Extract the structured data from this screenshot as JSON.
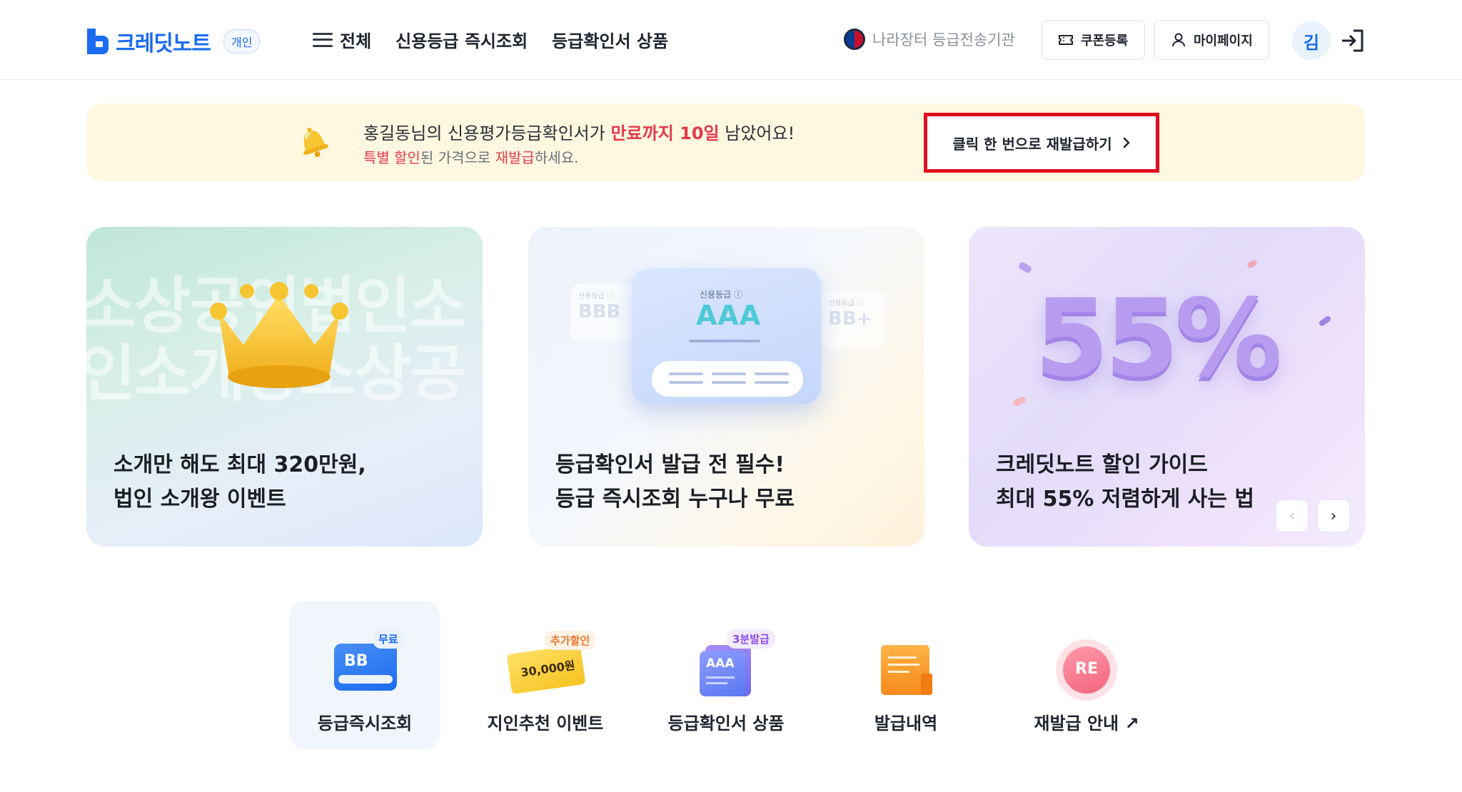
{
  "header": {
    "logo_text": "크레딧노트",
    "logo_badge": "개인",
    "nav": [
      {
        "label": "전체"
      },
      {
        "label": "신용등급 즉시조회"
      },
      {
        "label": "등급확인서 상품"
      }
    ],
    "gov_text": "나라장터 등급전송기관",
    "coupon_label": "쿠폰등록",
    "mypage_label": "마이페이지",
    "avatar_initial": "김"
  },
  "notice": {
    "line1_prefix": "홍길동님의 신용평가등급확인서가 ",
    "line1_highlight": "만료까지 10일",
    "line1_suffix": " 남았어요!",
    "line2_highlight1": "특별 할인",
    "line2_mid": "된 가격으로 ",
    "line2_highlight2": "재발급",
    "line2_suffix": "하세요.",
    "cta_label": "클릭 한 번으로 재발급하기",
    "highlight_color": "#e5394a",
    "focus_box_color": "#e01020"
  },
  "cards": [
    {
      "line1": "소개만 해도 최대 320만원,",
      "line2": "법인 소개왕 이벤트",
      "bg_text1": "소상공인법인소",
      "bg_text2": "인소개왕소상공"
    },
    {
      "line1": "등급확인서 발급 전 필수!",
      "line2": "등급 즉시조회 누구나 무료",
      "grade_main": "AAA",
      "grade_left": "BBB",
      "grade_right": "BB+",
      "grade_caption": "신용등급 ⓘ"
    },
    {
      "line1": "크레딧노트 할인 가이드",
      "line2": "최대 55% 저렴하게 사는 법",
      "percent_text": "55%"
    }
  ],
  "carousel": {
    "prev": "‹",
    "next": "›"
  },
  "quick_menu": [
    {
      "label": "등급즉시조회",
      "tag": "무료",
      "icon_text": "BB"
    },
    {
      "label": "지인추천 이벤트",
      "tag": "추가할인",
      "icon_text": "30,000원"
    },
    {
      "label": "등급확인서 상품",
      "tag": "3분발급",
      "icon_text": "AAA"
    },
    {
      "label": "발급내역"
    },
    {
      "label": "재발급 안내 ↗",
      "icon_text": "RE"
    }
  ],
  "colors": {
    "brand": "#1a6cf0",
    "notice_bg": "#fff8e0"
  }
}
